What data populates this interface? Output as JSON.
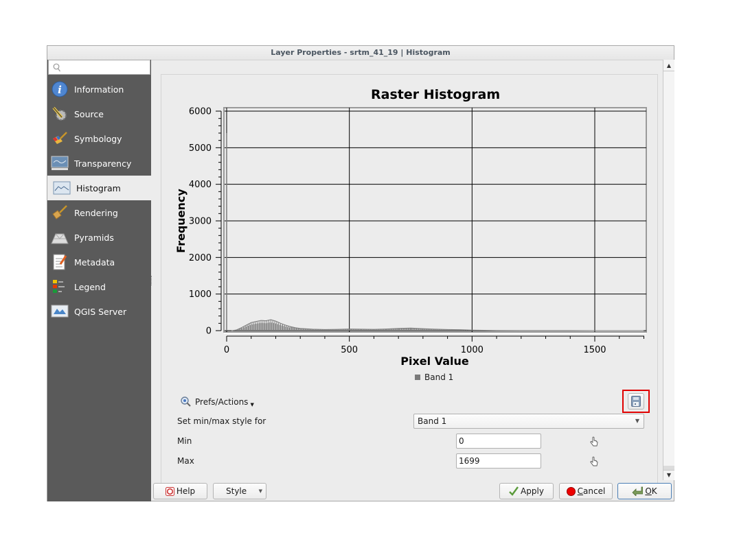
{
  "window": {
    "title": "Layer Properties - srtm_41_19 | Histogram"
  },
  "sidebar": {
    "search_placeholder": "",
    "items": [
      {
        "label": "Information",
        "icon": "info-icon"
      },
      {
        "label": "Source",
        "icon": "source-icon"
      },
      {
        "label": "Symbology",
        "icon": "symbology-icon"
      },
      {
        "label": "Transparency",
        "icon": "transparency-icon"
      },
      {
        "label": "Histogram",
        "icon": "histogram-icon",
        "active": true
      },
      {
        "label": "Rendering",
        "icon": "rendering-icon"
      },
      {
        "label": "Pyramids",
        "icon": "pyramids-icon"
      },
      {
        "label": "Metadata",
        "icon": "metadata-icon"
      },
      {
        "label": "Legend",
        "icon": "legend-icon"
      },
      {
        "label": "QGIS Server",
        "icon": "qgis-server-icon"
      }
    ]
  },
  "chart_data": {
    "type": "bar",
    "title": "Raster Histogram",
    "xlabel": "Pixel Value",
    "ylabel": "Frequency",
    "xlim": [
      0,
      1720
    ],
    "ylim": [
      0,
      6000
    ],
    "xticks": [
      0,
      500,
      1000,
      1500
    ],
    "xtick_labels": [
      "0",
      "500",
      "1000",
      "1500"
    ],
    "yticks": [
      0,
      1000,
      2000,
      3000,
      4000,
      5000,
      6000
    ],
    "ytick_labels": [
      "0",
      "1000",
      "2000",
      "3000",
      "4000",
      "5000",
      "6000"
    ],
    "grid": true,
    "legend": {
      "entries": [
        "Band 1"
      ],
      "placement": "bottom"
    },
    "series": [
      {
        "name": "Band 1",
        "color": "#7a7a7a",
        "points": [
          [
            0,
            5400
          ],
          [
            20,
            0
          ],
          [
            40,
            20
          ],
          [
            60,
            80
          ],
          [
            80,
            150
          ],
          [
            100,
            220
          ],
          [
            120,
            250
          ],
          [
            140,
            280
          ],
          [
            160,
            270
          ],
          [
            180,
            300
          ],
          [
            200,
            260
          ],
          [
            220,
            200
          ],
          [
            240,
            150
          ],
          [
            260,
            110
          ],
          [
            280,
            80
          ],
          [
            300,
            60
          ],
          [
            350,
            40
          ],
          [
            400,
            30
          ],
          [
            450,
            35
          ],
          [
            500,
            45
          ],
          [
            550,
            40
          ],
          [
            600,
            35
          ],
          [
            650,
            45
          ],
          [
            700,
            60
          ],
          [
            750,
            70
          ],
          [
            800,
            55
          ],
          [
            850,
            40
          ],
          [
            900,
            30
          ],
          [
            950,
            25
          ],
          [
            1000,
            15
          ],
          [
            1050,
            10
          ],
          [
            1100,
            5
          ],
          [
            1200,
            3
          ],
          [
            1300,
            2
          ],
          [
            1400,
            2
          ],
          [
            1500,
            1
          ],
          [
            1600,
            1
          ],
          [
            1699,
            1
          ]
        ]
      }
    ]
  },
  "prefs": {
    "label": "Prefs/Actions"
  },
  "form": {
    "minmax_label": "Set min/max style for",
    "band_selected": "Band 1",
    "min_label": "Min",
    "min_value": "0",
    "max_label": "Max",
    "max_value": "1699"
  },
  "buttons": {
    "help": "Help",
    "style": "Style",
    "apply": "Apply",
    "cancel_prefix": "",
    "cancel_mnemonic": "C",
    "cancel_rest": "ancel",
    "ok_mnemonic": "O",
    "ok_rest": "K"
  },
  "colors": {
    "highlight": "#e00000",
    "sidebar_bg": "#5a5a5a",
    "series": "#7a7a7a"
  }
}
